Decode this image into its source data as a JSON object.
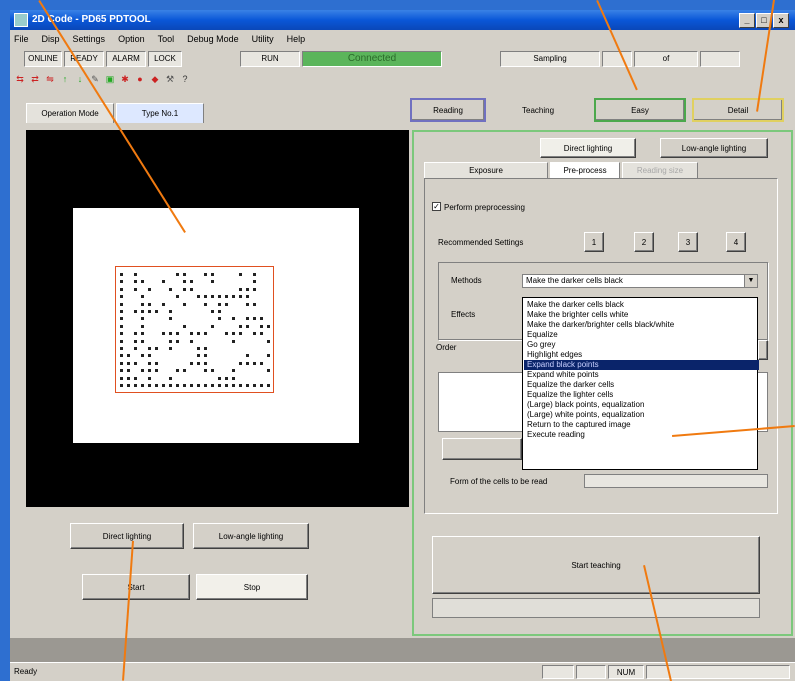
{
  "window": {
    "title": "2D Code - PD65 PDTOOL",
    "controls": [
      "_",
      "□",
      "x"
    ]
  },
  "menu": [
    "File",
    "Disp",
    "Settings",
    "Option",
    "Tool",
    "Debug Mode",
    "Utility",
    "Help"
  ],
  "status_bar_top": {
    "online": "ONLINE",
    "ready": "READY",
    "alarm": "ALARM",
    "lock": "LOCK",
    "run": "RUN",
    "connected": "Connected",
    "sampling_label": "Sampling",
    "of_label": "of"
  },
  "mode_tabs": {
    "operation": "Operation Mode",
    "type": "Type No.1"
  },
  "top_controls": {
    "reading": "Reading",
    "teaching_label": "Teaching",
    "easy": "Easy",
    "detail": "Detail"
  },
  "lighting_tabs": {
    "direct": "Direct lighting",
    "low_angle": "Low-angle lighting"
  },
  "settings_tabs": {
    "exposure": "Exposure",
    "preprocess": "Pre-process",
    "reading_size": "Reading size"
  },
  "preprocess": {
    "perform_label": "Perform preprocessing",
    "perform_checked": true,
    "recommended_label": "Recommended Settings",
    "presets": [
      "1",
      "2",
      "3",
      "4"
    ],
    "methods_label": "Methods",
    "methods_value": "Make the darker cells black",
    "effects_label": "Effects",
    "order_label": "Order",
    "form_label": "Form of the cells to be read"
  },
  "methods_options": [
    "Make the darker cells black",
    "Make the brighter cells white",
    "Make the darker/brighter cells black/white",
    "Equalize",
    "Go grey",
    "Highlight edges",
    "Expand black points",
    "Expand white points",
    "Equalize the darker cells",
    "Equalize the lighter cells",
    "(Large) black points, equalization",
    "(Large) white points, equalization",
    "Return to the captured image",
    "Execute reading"
  ],
  "methods_selected_index": 6,
  "bottom_left": {
    "direct": "Direct lighting",
    "low_angle": "Low-angle lighting",
    "start": "Start",
    "stop": "Stop"
  },
  "start_teaching": "Start teaching",
  "statusbar": {
    "ready": "Ready",
    "num": "NUM"
  },
  "colors": {
    "accent_green": "#7cc87c",
    "connected_green": "#5bb55b",
    "callout_orange": "#f07a10",
    "selection_navy": "#0a246a"
  }
}
